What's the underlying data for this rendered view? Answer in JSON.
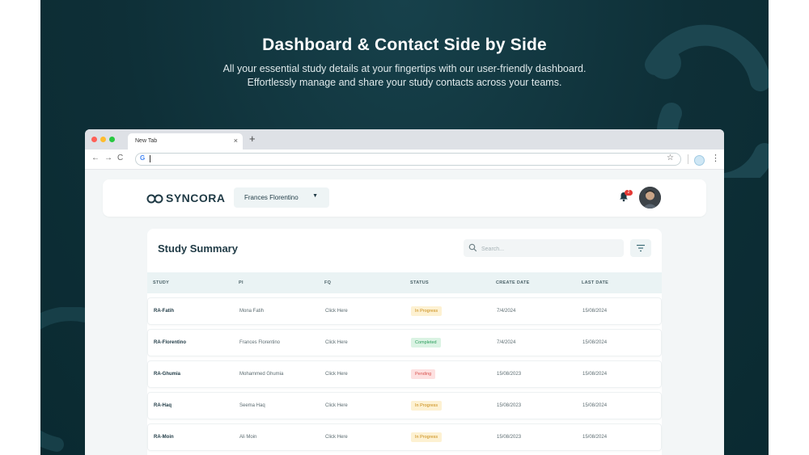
{
  "hero": {
    "title": "Dashboard & Contact Side by Side",
    "subtitle_line1": "All your essential study details at your fingertips with our user-friendly dashboard.",
    "subtitle_line2": "Effortlessly manage and share your study contacts across your teams."
  },
  "browser": {
    "tab_title": "New Tab",
    "tab_close": "×",
    "new_tab": "+",
    "back": "←",
    "forward": "→",
    "reload": "C",
    "address_icon": "G",
    "address_value": "",
    "bookmark": "☆",
    "menu": "⋮"
  },
  "app": {
    "logo_text": "SYNCORA",
    "user_name": "Frances Florentino",
    "user_caret": "▼",
    "notification_count": "2"
  },
  "summary": {
    "title": "Study Summary",
    "search_placeholder": "Search...",
    "columns": [
      "STUDY",
      "PI",
      "FQ",
      "STATUS",
      "CREATE DATE",
      "LAST DATE"
    ],
    "rows": [
      {
        "study": "RA-Fatih",
        "pi": "Mona Fatih",
        "fq": "Click Here",
        "status": "In Progress",
        "create_date": "7/4/2024",
        "last_date": "15/08/2024"
      },
      {
        "study": "RA-Florentino",
        "pi": "Frances Florentino",
        "fq": "Click Here",
        "status": "Completed",
        "create_date": "7/4/2024",
        "last_date": "15/08/2024"
      },
      {
        "study": "RA-Ghumia",
        "pi": "Mohammed Ghumia",
        "fq": "Click Here",
        "status": "Pending",
        "create_date": "15/08/2023",
        "last_date": "15/08/2024"
      },
      {
        "study": "RA-Haq",
        "pi": "Seema Haq",
        "fq": "Click Here",
        "status": "In Progress",
        "create_date": "15/08/2023",
        "last_date": "15/08/2024"
      },
      {
        "study": "RA-Moin",
        "pi": "Ali Moin",
        "fq": "Click Here",
        "status": "In Progress",
        "create_date": "15/08/2023",
        "last_date": "15/08/2024"
      }
    ]
  },
  "colors": {
    "background": "#0e2f37",
    "in_progress_bg": "#fdf1d2",
    "in_progress_text": "#c98a12",
    "completed_bg": "#daf3e3",
    "completed_text": "#2a9d5b",
    "pending_bg": "#fde0e0",
    "pending_text": "#d9534f"
  }
}
